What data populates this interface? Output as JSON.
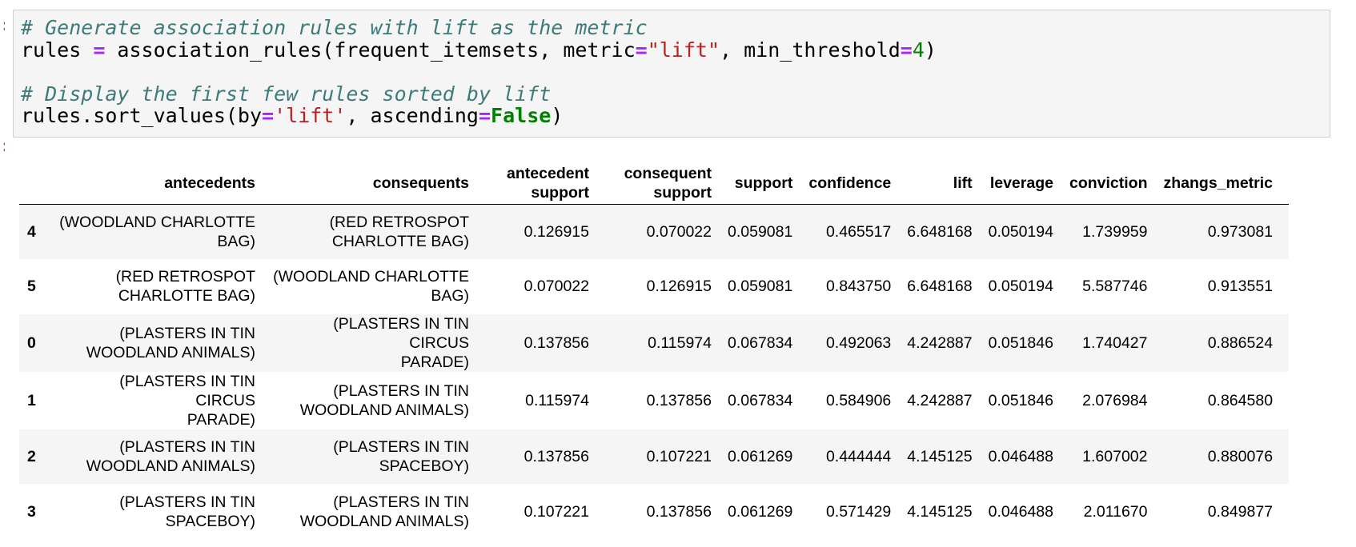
{
  "code_cell": {
    "lines": [
      [
        {
          "t": "# Generate association rules with lift as the metric",
          "c": "comment"
        }
      ],
      [
        {
          "t": "rules ",
          "c": ""
        },
        {
          "t": "=",
          "c": "op"
        },
        {
          "t": " association_rules(frequent_itemsets, metric",
          "c": ""
        },
        {
          "t": "=",
          "c": "op"
        },
        {
          "t": "\"lift\"",
          "c": "str"
        },
        {
          "t": ", min_threshold",
          "c": ""
        },
        {
          "t": "=",
          "c": "op"
        },
        {
          "t": "4",
          "c": "num"
        },
        {
          "t": ")",
          "c": ""
        }
      ],
      [],
      [
        {
          "t": "# Display the first few rules sorted by lift",
          "c": "comment"
        }
      ],
      [
        {
          "t": "rules.sort_values(by",
          "c": ""
        },
        {
          "t": "=",
          "c": "op"
        },
        {
          "t": "'lift'",
          "c": "str"
        },
        {
          "t": ", ascending",
          "c": ""
        },
        {
          "t": "=",
          "c": "op"
        },
        {
          "t": "False",
          "c": "kw"
        },
        {
          "t": ")",
          "c": ""
        }
      ]
    ]
  },
  "output_table": {
    "columns": [
      {
        "key": "antecedents",
        "lines": [
          "antecedents"
        ]
      },
      {
        "key": "consequents",
        "lines": [
          "consequents"
        ]
      },
      {
        "key": "antecedent_support",
        "lines": [
          "antecedent",
          "support"
        ]
      },
      {
        "key": "consequent_support",
        "lines": [
          "consequent",
          "support"
        ]
      },
      {
        "key": "support",
        "lines": [
          "support"
        ]
      },
      {
        "key": "confidence",
        "lines": [
          "confidence"
        ]
      },
      {
        "key": "lift",
        "lines": [
          "lift"
        ]
      },
      {
        "key": "leverage",
        "lines": [
          "leverage"
        ]
      },
      {
        "key": "conviction",
        "lines": [
          "conviction"
        ]
      },
      {
        "key": "zhangs_metric",
        "lines": [
          "zhangs_metric"
        ]
      }
    ],
    "rows": [
      {
        "index": "4",
        "cells": [
          [
            "(WOODLAND CHARLOTTE",
            "BAG)"
          ],
          [
            "(RED RETROSPOT",
            "CHARLOTTE BAG)"
          ],
          [
            "0.126915"
          ],
          [
            "0.070022"
          ],
          [
            "0.059081"
          ],
          [
            "0.465517"
          ],
          [
            "6.648168"
          ],
          [
            "0.050194"
          ],
          [
            "1.739959"
          ],
          [
            "0.973081"
          ]
        ]
      },
      {
        "index": "5",
        "cells": [
          [
            "(RED RETROSPOT",
            "CHARLOTTE BAG)"
          ],
          [
            "(WOODLAND CHARLOTTE",
            "BAG)"
          ],
          [
            "0.070022"
          ],
          [
            "0.126915"
          ],
          [
            "0.059081"
          ],
          [
            "0.843750"
          ],
          [
            "6.648168"
          ],
          [
            "0.050194"
          ],
          [
            "5.587746"
          ],
          [
            "0.913551"
          ]
        ]
      },
      {
        "index": "0",
        "cells": [
          [
            "(PLASTERS IN TIN",
            "WOODLAND ANIMALS)"
          ],
          [
            "(PLASTERS IN TIN CIRCUS",
            "PARADE)"
          ],
          [
            "0.137856"
          ],
          [
            "0.115974"
          ],
          [
            "0.067834"
          ],
          [
            "0.492063"
          ],
          [
            "4.242887"
          ],
          [
            "0.051846"
          ],
          [
            "1.740427"
          ],
          [
            "0.886524"
          ]
        ]
      },
      {
        "index": "1",
        "cells": [
          [
            "(PLASTERS IN TIN CIRCUS",
            "PARADE)"
          ],
          [
            "(PLASTERS IN TIN",
            "WOODLAND ANIMALS)"
          ],
          [
            "0.115974"
          ],
          [
            "0.137856"
          ],
          [
            "0.067834"
          ],
          [
            "0.584906"
          ],
          [
            "4.242887"
          ],
          [
            "0.051846"
          ],
          [
            "2.076984"
          ],
          [
            "0.864580"
          ]
        ]
      },
      {
        "index": "2",
        "cells": [
          [
            "(PLASTERS IN TIN",
            "WOODLAND ANIMALS)"
          ],
          [
            "(PLASTERS IN TIN",
            "SPACEBOY)"
          ],
          [
            "0.137856"
          ],
          [
            "0.107221"
          ],
          [
            "0.061269"
          ],
          [
            "0.444444"
          ],
          [
            "4.145125"
          ],
          [
            "0.046488"
          ],
          [
            "1.607002"
          ],
          [
            "0.880076"
          ]
        ]
      },
      {
        "index": "3",
        "cells": [
          [
            "(PLASTERS IN TIN",
            "SPACEBOY)"
          ],
          [
            "(PLASTERS IN TIN",
            "WOODLAND ANIMALS)"
          ],
          [
            "0.107221"
          ],
          [
            "0.137856"
          ],
          [
            "0.061269"
          ],
          [
            "0.571429"
          ],
          [
            "4.145125"
          ],
          [
            "0.046488"
          ],
          [
            "2.011670"
          ],
          [
            "0.849877"
          ]
        ]
      }
    ]
  }
}
